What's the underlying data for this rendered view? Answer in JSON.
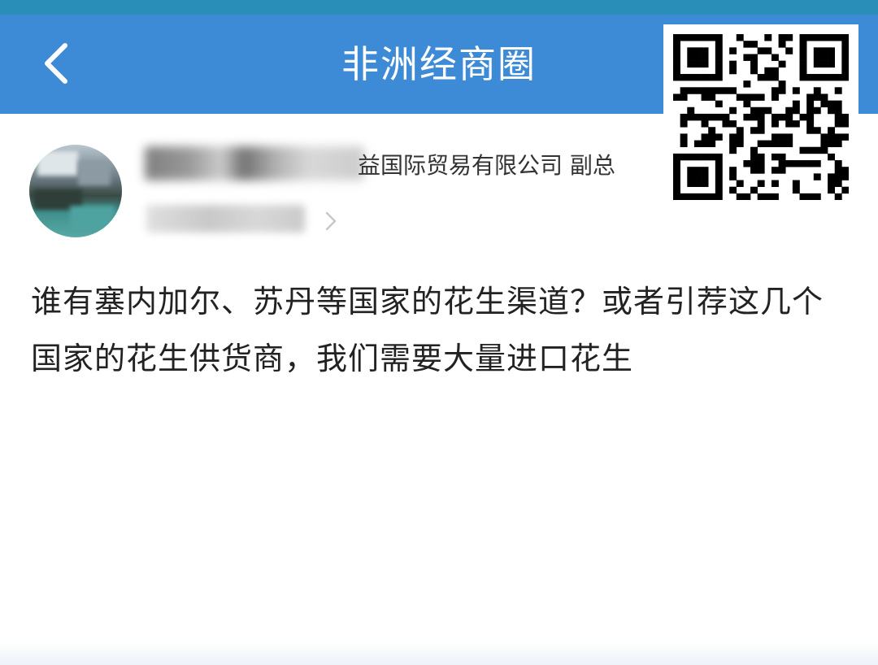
{
  "header": {
    "title": "非洲经商圈",
    "back_icon": "chevron-left-icon",
    "background_color": "#3d8bd6"
  },
  "post": {
    "author_company": "益国际贸易有限公司 副总",
    "body": "谁有塞内加尔、苏丹等国家的花生渠道？或者引荐这几个国家的花生供货商，我们需要大量进口花生"
  },
  "overlay": {
    "qr_icon": "qr-code-icon"
  }
}
